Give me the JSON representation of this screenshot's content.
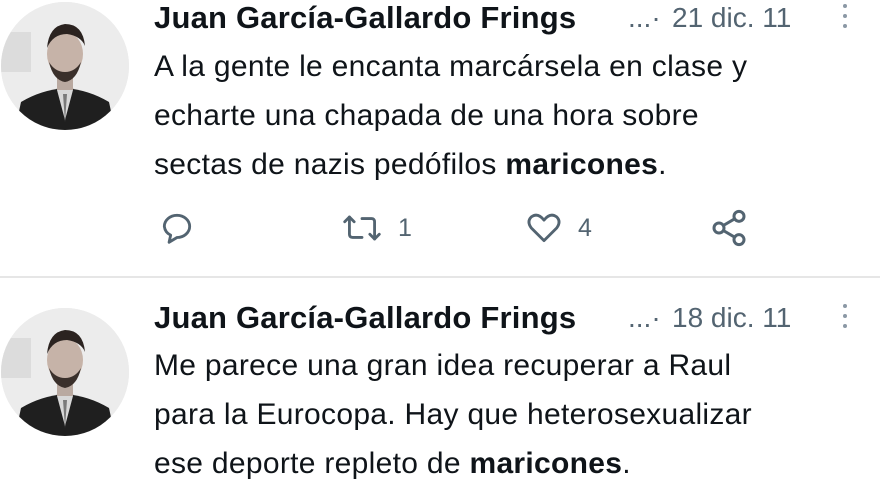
{
  "tweets": [
    {
      "author": "Juan García-Gallardo Frings",
      "separator": "...·",
      "date": "21 dic. 11",
      "text_line1": "A la gente le encanta marcársela en clase y",
      "text_line2": "echarte una chapada de una hora sobre",
      "text_line3_pre": "sectas de nazis pedófilos ",
      "text_line3_bold": "maricones",
      "text_line3_post": ".",
      "retweets": "1",
      "likes": "4"
    },
    {
      "author": "Juan García-Gallardo Frings",
      "separator": "...·",
      "date": "18 dic. 11",
      "text_line1": "Me parece una gran idea recuperar a Raul",
      "text_line2": "para la Eurocopa. Hay que heterosexualizar",
      "text_line3_pre": "ese deporte repleto de ",
      "text_line3_bold": "maricones",
      "text_line3_post": "."
    }
  ],
  "colors": {
    "text": "#0f1419",
    "muted": "#536471",
    "divider": "#e6e6e6"
  },
  "icons": [
    "reply-icon",
    "retweet-icon",
    "like-icon",
    "share-icon",
    "more-icon"
  ]
}
